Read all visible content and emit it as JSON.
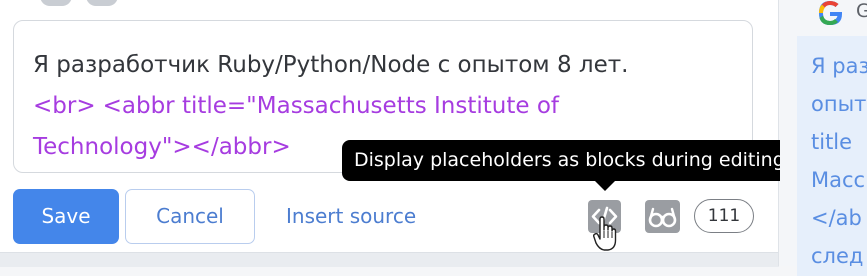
{
  "editor": {
    "line1": "Я разработчик Ruby/Python/Node с опытом 8 лет.",
    "line2_tag1": "<br>",
    "line2_tag2": "<abbr title=\"Massachusetts Institute of",
    "line3_text": "Technology\"></abbr>"
  },
  "actions": {
    "save_label": "Save",
    "cancel_label": "Cancel",
    "insert_source_label": "Insert source"
  },
  "toolbar": {
    "code_icon": "code-brackets-icon",
    "glasses_icon": "glasses-icon",
    "counter": "111"
  },
  "tooltip": {
    "text": "Display placeholders as blocks during editing"
  },
  "right_panel": {
    "header": "G",
    "lines": [
      "Я раз",
      "опыт",
      "title",
      "Масс",
      "</ab",
      "след"
    ]
  },
  "colors": {
    "accent": "#4486ea",
    "link": "#4c7dd0",
    "tag": "#a63ce0",
    "tooltip_bg": "#000000"
  }
}
